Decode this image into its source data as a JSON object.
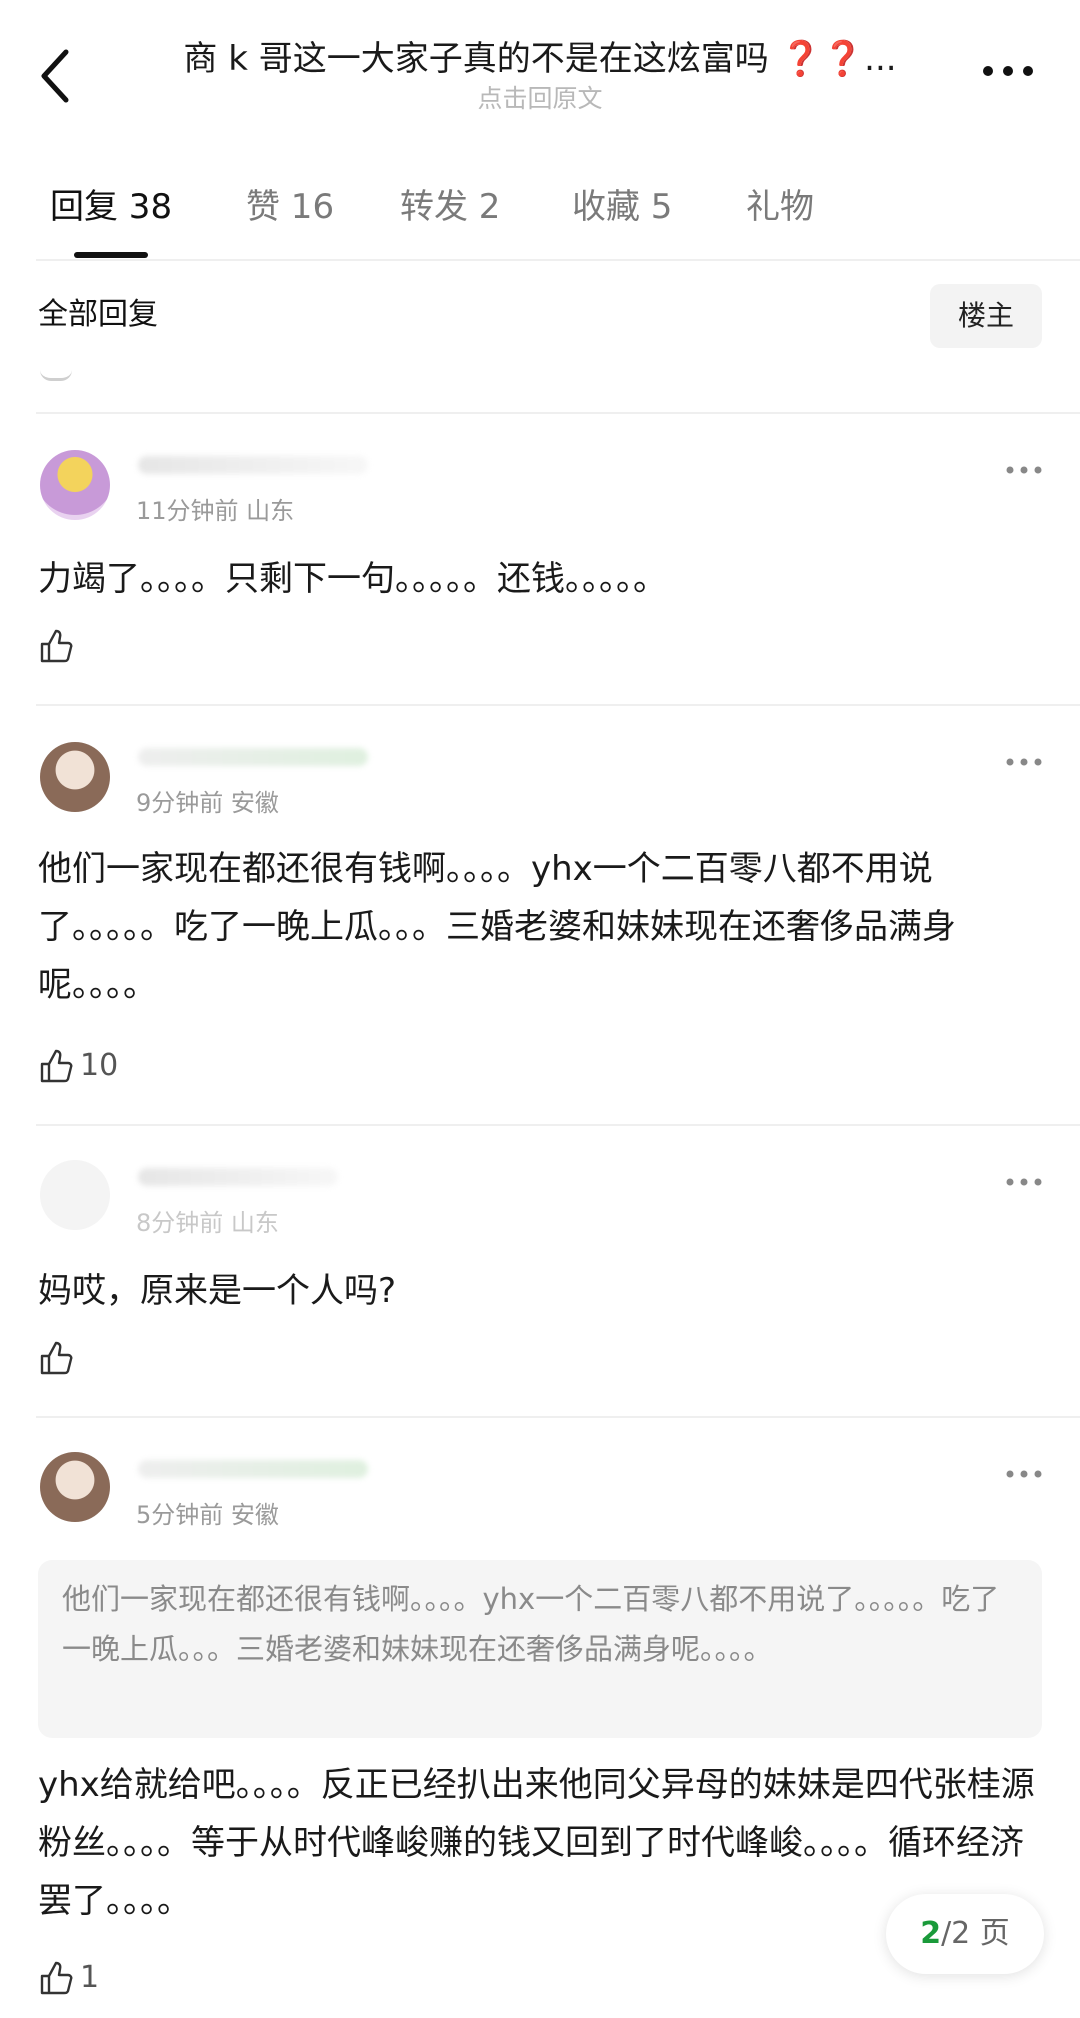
{
  "header": {
    "title": "商 k 哥这一大家子真的不是在这炫富吗 ❓❓...",
    "subtitle": "点击回原文"
  },
  "tabs": [
    {
      "label": "回复 38"
    },
    {
      "label": "赞 16"
    },
    {
      "label": "转发 2"
    },
    {
      "label": "收藏 5"
    },
    {
      "label": "礼物"
    }
  ],
  "filter": {
    "label": "全部回复",
    "owner_button": "楼主"
  },
  "comments": [
    {
      "meta": "11分钟前 山东",
      "text": "力竭了。。。。只剩下一句。。。。。还钱。。。。。",
      "likes": ""
    },
    {
      "meta": "9分钟前 安徽",
      "text": "他们一家现在都还很有钱啊。。。。yhx一个二百零八都不用说了。。。。。吃了一晚上瓜。。。三婚老婆和妹妹现在还奢侈品满身呢。。。。",
      "likes": "10"
    },
    {
      "meta": "8分钟前 山东",
      "text": "妈哎，原来是一个人吗?",
      "likes": ""
    },
    {
      "meta": "5分钟前 安徽",
      "quote": "他们一家现在都还很有钱啊。。。。yhx一个二百零八都不用说了。。。。。吃了一晚上瓜。。。三婚老婆和妹妹现在还奢侈品满身呢。。。。",
      "text": "yhx给就给吧。。。。反正已经扒出来他同父异母的妹妹是四代张桂源粉丝。。。。等于从时代峰峻赚的钱又回到了时代峰峻。。。。循环经济罢了。。。。",
      "likes": "1"
    }
  ],
  "pager": {
    "current": "2",
    "total": "/2 页"
  }
}
